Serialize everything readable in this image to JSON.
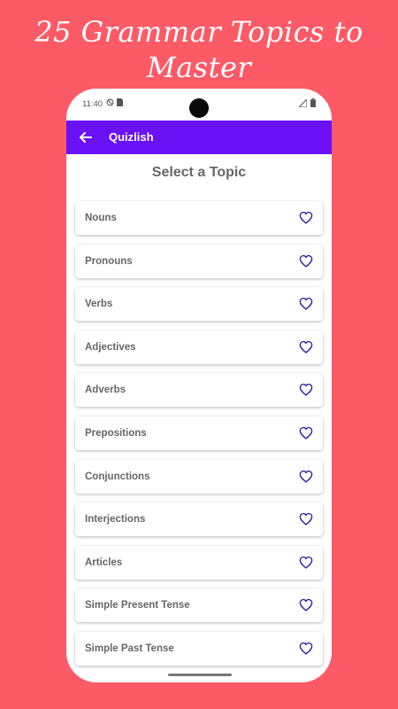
{
  "promo": {
    "title_line1": "25 Grammar Topics to",
    "title_line2": "Master"
  },
  "status_bar": {
    "time": "11:40",
    "icons": [
      "do-not-disturb-icon",
      "sim-icon",
      "signal-icon",
      "battery-icon"
    ]
  },
  "app_bar": {
    "back_icon": "arrow-left-icon",
    "title": "Quizlish",
    "color": "#6a11f5"
  },
  "screen": {
    "title": "Select a Topic"
  },
  "topics": [
    {
      "label": "Nouns"
    },
    {
      "label": "Pronouns"
    },
    {
      "label": "Verbs"
    },
    {
      "label": "Adjectives"
    },
    {
      "label": "Adverbs"
    },
    {
      "label": "Prepositions"
    },
    {
      "label": "Conjunctions"
    },
    {
      "label": "Interjections"
    },
    {
      "label": "Articles"
    },
    {
      "label": "Simple Present Tense"
    },
    {
      "label": "Simple Past Tense"
    }
  ],
  "colors": {
    "background": "#fd5a67",
    "heart_outline": "#2a1a9e"
  }
}
